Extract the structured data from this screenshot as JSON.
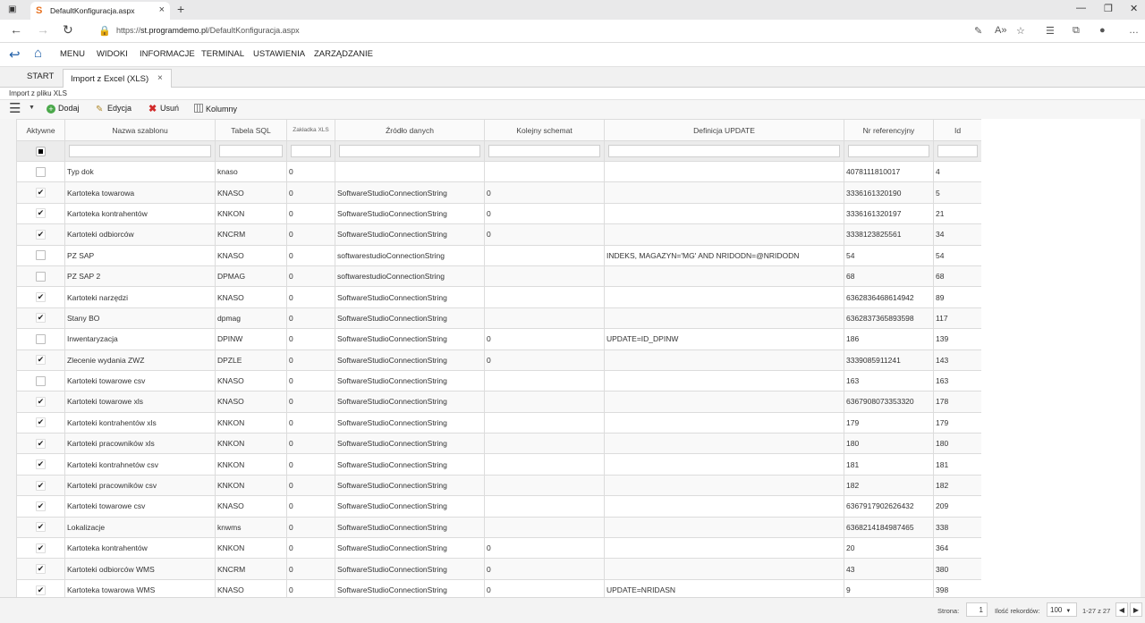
{
  "browser": {
    "tab_title": "DefaultKonfiguracja.aspx",
    "url_prefix": "https://",
    "url_host": "st.programdemo.pl",
    "url_path": "/DefaultKonfiguracja.aspx",
    "newtab": "+",
    "close": "×"
  },
  "menu": {
    "items": [
      "MENU",
      "WIDOKI",
      "INFORMACJE",
      "TERMINAL",
      "USTAWIENIA",
      "ZARZĄDZANIE"
    ]
  },
  "tabs": {
    "start": "START",
    "active": "Import z Excel (XLS)",
    "close": "×"
  },
  "breadcrumb": "Import z pliku XLS",
  "toolbar": {
    "add": "Dodaj",
    "edit": "Edycja",
    "delete": "Usuń",
    "columns": "Kolumny"
  },
  "grid": {
    "columns": [
      "Aktywne",
      "Nazwa szablonu",
      "Tabela SQL",
      "Zakładka XLS",
      "Źródło danych",
      "Kolejny schemat",
      "Definicja UPDATE",
      "Nr referencyjny",
      "Id"
    ],
    "rows": [
      {
        "active": false,
        "name": "Typ dok",
        "table": "knaso",
        "sheet": "0",
        "source": "",
        "next": "",
        "update": "",
        "ref": "4078111810017",
        "id": "4"
      },
      {
        "active": true,
        "name": "Kartoteka towarowa",
        "table": "KNASO",
        "sheet": "0",
        "source": "SoftwareStudioConnectionString",
        "next": "0",
        "update": "",
        "ref": "3336161320190",
        "id": "5"
      },
      {
        "active": true,
        "name": "Kartoteka kontrahentów",
        "table": "KNKON",
        "sheet": "0",
        "source": "SoftwareStudioConnectionString",
        "next": "0",
        "update": "",
        "ref": "3336161320197",
        "id": "21"
      },
      {
        "active": true,
        "name": "Kartoteki odbiorców",
        "table": "KNCRM",
        "sheet": "0",
        "source": "SoftwareStudioConnectionString",
        "next": "0",
        "update": "",
        "ref": "3338123825561",
        "id": "34"
      },
      {
        "active": false,
        "name": "PZ SAP",
        "table": "KNASO",
        "sheet": "0",
        "source": "softwarestudioConnectionString",
        "next": "",
        "update": "INDEKS, MAGAZYN='MG' AND NRIDODN=@NRIDODN",
        "ref": "54",
        "id": "54"
      },
      {
        "active": false,
        "name": "PZ SAP 2",
        "table": "DPMAG",
        "sheet": "0",
        "source": "softwarestudioConnectionString",
        "next": "",
        "update": "",
        "ref": "68",
        "id": "68"
      },
      {
        "active": true,
        "name": "Kartoteki narzędzi",
        "table": "KNASO",
        "sheet": "0",
        "source": "SoftwareStudioConnectionString",
        "next": "",
        "update": "",
        "ref": "6362836468614942",
        "id": "89"
      },
      {
        "active": true,
        "name": "Stany BO",
        "table": "dpmag",
        "sheet": "0",
        "source": "SoftwareStudioConnectionString",
        "next": "",
        "update": "",
        "ref": "6362837365893598",
        "id": "117"
      },
      {
        "active": false,
        "name": "Inwentaryzacja",
        "table": "DPINW",
        "sheet": "0",
        "source": "SoftwareStudioConnectionString",
        "next": "0",
        "update": "UPDATE=ID_DPINW",
        "ref": "186",
        "id": "139"
      },
      {
        "active": true,
        "name": "Zlecenie wydania ZWZ",
        "table": "DPZLE",
        "sheet": "0",
        "source": "SoftwareStudioConnectionString",
        "next": "0",
        "update": "",
        "ref": "3339085911241",
        "id": "143"
      },
      {
        "active": false,
        "name": "Kartoteki towarowe csv",
        "table": "KNASO",
        "sheet": "0",
        "source": "SoftwareStudioConnectionString",
        "next": "",
        "update": "",
        "ref": "163",
        "id": "163"
      },
      {
        "active": true,
        "name": "Kartoteki towarowe xls",
        "table": "KNASO",
        "sheet": "0",
        "source": "SoftwareStudioConnectionString",
        "next": "",
        "update": "",
        "ref": "6367908073353320",
        "id": "178"
      },
      {
        "active": true,
        "name": "Kartoteki kontrahentów xls",
        "table": "KNKON",
        "sheet": "0",
        "source": "SoftwareStudioConnectionString",
        "next": "",
        "update": "",
        "ref": "179",
        "id": "179"
      },
      {
        "active": true,
        "name": "Kartoteki pracowników xls",
        "table": "KNKON",
        "sheet": "0",
        "source": "SoftwareStudioConnectionString",
        "next": "",
        "update": "",
        "ref": "180",
        "id": "180"
      },
      {
        "active": true,
        "name": "Kartoteki kontrahnetów csv",
        "table": "KNKON",
        "sheet": "0",
        "source": "SoftwareStudioConnectionString",
        "next": "",
        "update": "",
        "ref": "181",
        "id": "181"
      },
      {
        "active": true,
        "name": "Kartoteki pracowników csv",
        "table": "KNKON",
        "sheet": "0",
        "source": "SoftwareStudioConnectionString",
        "next": "",
        "update": "",
        "ref": "182",
        "id": "182"
      },
      {
        "active": true,
        "name": "Kartoteki towarowe csv",
        "table": "KNASO",
        "sheet": "0",
        "source": "SoftwareStudioConnectionString",
        "next": "",
        "update": "",
        "ref": "6367917902626432",
        "id": "209"
      },
      {
        "active": true,
        "name": "Lokalizacje",
        "table": "knwms",
        "sheet": "0",
        "source": "SoftwareStudioConnectionString",
        "next": "",
        "update": "",
        "ref": "6368214184987465",
        "id": "338"
      },
      {
        "active": true,
        "name": "Kartoteka kontrahentów",
        "table": "KNKON",
        "sheet": "0",
        "source": "SoftwareStudioConnectionString",
        "next": "0",
        "update": "",
        "ref": "20",
        "id": "364"
      },
      {
        "active": true,
        "name": "Kartoteki odbiorców WMS",
        "table": "KNCRM",
        "sheet": "0",
        "source": "SoftwareStudioConnectionString",
        "next": "0",
        "update": "",
        "ref": "43",
        "id": "380"
      },
      {
        "active": true,
        "name": "Kartoteka towarowa WMS",
        "table": "KNASO",
        "sheet": "0",
        "source": "SoftwareStudioConnectionString",
        "next": "0",
        "update": "UPDATE=NRIDASN",
        "ref": "9",
        "id": "398"
      }
    ]
  },
  "footer": {
    "page_label": "Strona:",
    "page_value": "1",
    "records_label": "Ilość rekordów:",
    "records_value": "100",
    "range": "1-27 z 27"
  }
}
